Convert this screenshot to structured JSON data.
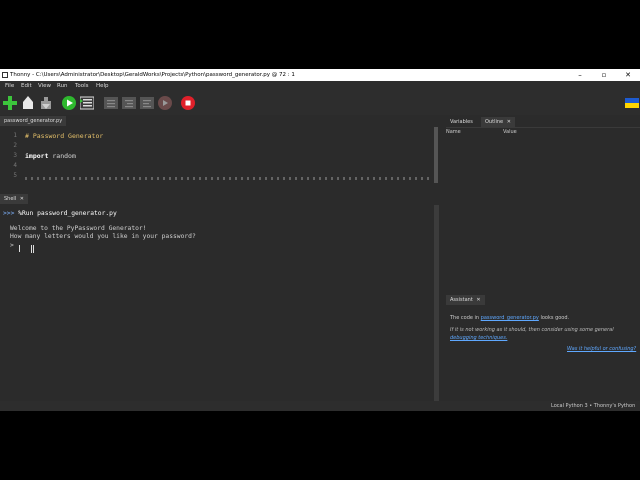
{
  "window": {
    "title": "Thonny  -  C:\\Users\\Administrator\\Desktop\\GeraldWorks\\Projects\\Python\\password_generator.py  @  72 : 1"
  },
  "menu": [
    "File",
    "Edit",
    "View",
    "Run",
    "Tools",
    "Help"
  ],
  "toolbar": {
    "icons": [
      "new-file-icon",
      "open-file-icon",
      "save-file-icon",
      "run-icon",
      "debug-icon",
      "step-over-icon",
      "step-into-icon",
      "step-out-icon",
      "resume-icon",
      "stop-icon"
    ],
    "colors": {
      "new": "#3cc53c",
      "run": "#2eb82e",
      "stop": "#e0202a"
    }
  },
  "editor": {
    "tab_label": "password_generator.py",
    "lines": [
      {
        "n": "1",
        "comment": "# Password Generator"
      },
      {
        "n": "2"
      },
      {
        "n": "3",
        "kw": "import",
        "rest": " random"
      },
      {
        "n": "4"
      },
      {
        "n": "5"
      }
    ]
  },
  "shell": {
    "tab_label": "Shell",
    "prompt": ">>>",
    "command": " %Run password_generator.py",
    "output": [
      "Welcome to the PyPassword Generator!",
      "How many letters would you like in your password?"
    ],
    "input_prompt": ">"
  },
  "variables": {
    "tabs": [
      "Variables",
      "Outline"
    ],
    "col_name": "Name",
    "col_value": "Value"
  },
  "assistant": {
    "tab_label": "Assistant",
    "line1_pre": "The code in ",
    "line1_link": "password_generator.py",
    "line1_post": " looks good.",
    "line2": "If it is not working as it should, then consider using some general",
    "line3": "debugging techniques.",
    "feedback_link": "Was it helpful or confusing?"
  },
  "statusbar": {
    "interpreter": "Local Python 3  •  Thonny's Python"
  }
}
